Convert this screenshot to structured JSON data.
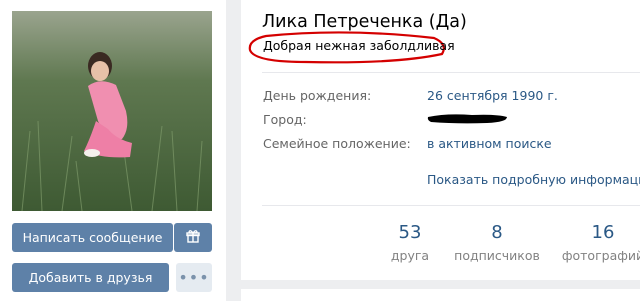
{
  "profile": {
    "name": "Лика Петреченка (Да)",
    "status": "Добрая нежная заболдливая"
  },
  "actions": {
    "message_label": "Написать сообщение",
    "add_friend_label": "Добавить в друзья",
    "gift_icon": "gift-icon",
    "more_icon": "more-dots-icon"
  },
  "info": [
    {
      "label": "День рождения:",
      "value": "26 сентября 1990 г."
    },
    {
      "label": "Город:",
      "value": ""
    },
    {
      "label": "Семейное положение:",
      "value": "в активном поиске"
    }
  ],
  "show_details_label": "Показать подробную информацию",
  "counters": [
    {
      "number": "53",
      "caption": "друга"
    },
    {
      "number": "8",
      "caption": "подписчиков"
    },
    {
      "number": "16",
      "caption": "фотографий"
    }
  ],
  "colors": {
    "accent": "#5e81a8",
    "link": "#2a5885",
    "annotation": "#d40000"
  }
}
